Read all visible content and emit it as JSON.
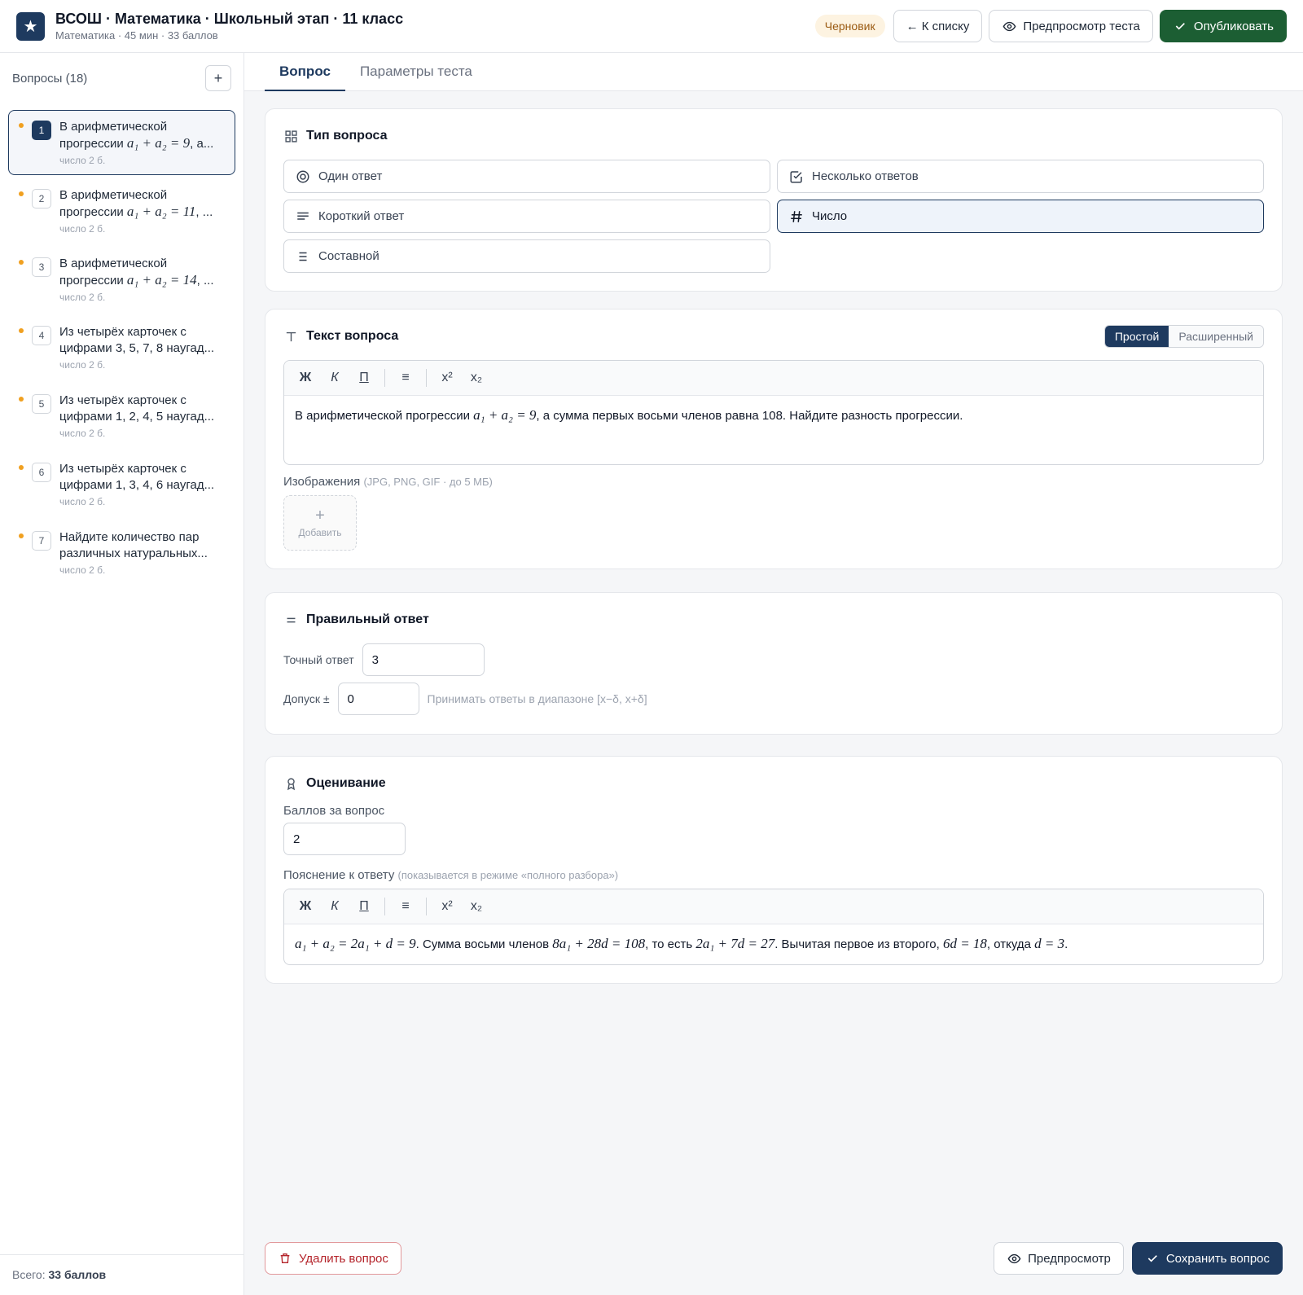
{
  "header": {
    "logo_glyph": "★",
    "title": "ВСОШ · Математика · Школьный этап · 11 класс",
    "subtitle": "Математика · 45 мин · 33 баллов",
    "status": "Черновик",
    "back_label": "← К списку",
    "preview_label": "Предпросмотр теста",
    "publish_label": "Опубликовать"
  },
  "sidebar": {
    "title": "Вопросы (18)",
    "add_label": "+",
    "items": [
      {
        "num": "1",
        "text_before": "В арифметической прогрессии ",
        "math": "a₁ + a₂ = 9",
        "text_after": ", а...",
        "meta": "число  2 б."
      },
      {
        "num": "2",
        "text_before": "В арифметической прогрессии ",
        "math": "a₁ + a₂ = 11",
        "text_after": ", ...",
        "meta": "число  2 б."
      },
      {
        "num": "3",
        "text_before": "В арифметической прогрессии ",
        "math": "a₁ + a₂ = 14",
        "text_after": ", ...",
        "meta": "число  2 б."
      },
      {
        "num": "4",
        "text_before": "Из четырёх карточек с цифрами 3, 5, 7, 8 наугад...",
        "math": "",
        "text_after": "",
        "meta": "число  2 б."
      },
      {
        "num": "5",
        "text_before": "Из четырёх карточек с цифрами 1, 2, 4, 5 наугад...",
        "math": "",
        "text_after": "",
        "meta": "число  2 б."
      },
      {
        "num": "6",
        "text_before": "Из четырёх карточек с цифрами 1, 3, 4, 6 наугад...",
        "math": "",
        "text_after": "",
        "meta": "число  2 б."
      },
      {
        "num": "7",
        "text_before": "Найдите количество пар различных натуральных...",
        "math": "",
        "text_after": "",
        "meta": "число  2 б."
      }
    ],
    "footer_label": "Всего:",
    "footer_value": "33 баллов"
  },
  "tabs": [
    {
      "label": "Вопрос",
      "active": true
    },
    {
      "label": "Параметры теста",
      "active": false
    }
  ],
  "question_type": {
    "title": "Тип вопроса",
    "options": [
      {
        "label": "Один ответ",
        "icon": "radio-icon"
      },
      {
        "label": "Несколько ответов",
        "icon": "checkbox-icon"
      },
      {
        "label": "Короткий ответ",
        "icon": "text-lines-icon"
      },
      {
        "label": "Число",
        "icon": "hash-icon",
        "selected": true
      },
      {
        "label": "Составной",
        "icon": "list-icon"
      }
    ]
  },
  "question_text": {
    "title": "Текст вопроса",
    "mode_simple": "Простой",
    "mode_advanced": "Расширенный",
    "toolbar": {
      "bold": "Ж",
      "italic": "К",
      "underline": "П",
      "list": "≡",
      "sup": "x²",
      "sub": "x₂"
    },
    "before": "В арифметической прогрессии ",
    "math": "a₁ + a₂ = 9",
    "after": ", а сумма первых восьми членов равна 108. Найдите разность прогрессии.",
    "images_label": "Изображения",
    "images_hint": "(JPG, PNG, GIF · до 5 МБ)",
    "add_image_plus": "+",
    "add_image_label": "Добавить"
  },
  "correct_answer": {
    "title": "Правильный ответ",
    "exact_label": "Точный ответ",
    "exact_value": "3",
    "tolerance_label": "Допуск ±",
    "tolerance_value": "0",
    "tolerance_hint": "Принимать ответы в диапазоне [x−δ, x+δ]"
  },
  "grading": {
    "title": "Оценивание",
    "points_label": "Баллов за вопрос",
    "points_value": "2",
    "explanation_label": "Пояснение к ответу",
    "explanation_hint": "(показывается в режиме «полного разбора»)",
    "explanation_parts": [
      "a₁ + a₂ = 2a₁ + d = 9",
      ". Сумма восьми членов ",
      "8a₁ + 28d = 108",
      ", то есть ",
      "2a₁ + 7d = 27",
      ". Вычитая первое из второго, ",
      "6d = 18",
      ", откуда ",
      "d = 3",
      "."
    ]
  },
  "footer": {
    "delete_label": "Удалить вопрос",
    "preview_label": "Предпросмотр",
    "save_label": "Сохранить вопрос"
  },
  "colors": {
    "accent": "#1e3a5f",
    "publish": "#1c5e33",
    "status_dot": "#f0a020",
    "danger": "#b4232a"
  }
}
